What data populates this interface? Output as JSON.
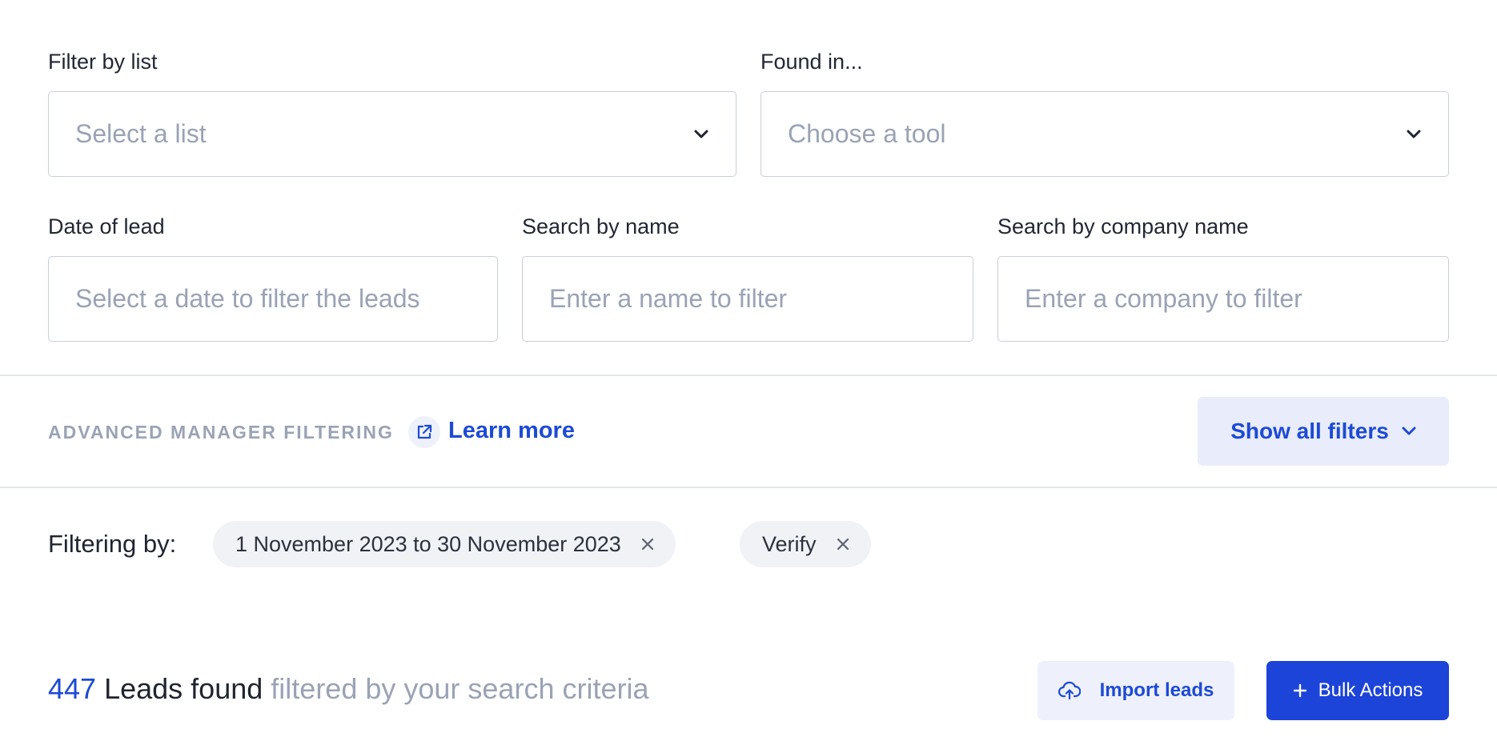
{
  "filters": {
    "list": {
      "label": "Filter by list",
      "placeholder": "Select a list"
    },
    "found_in": {
      "label": "Found in...",
      "placeholder": "Choose a tool"
    },
    "date": {
      "label": "Date of lead",
      "placeholder": "Select a date to filter the leads"
    },
    "name": {
      "label": "Search by name",
      "placeholder": "Enter a name to filter"
    },
    "company": {
      "label": "Search by company name",
      "placeholder": "Enter a company to filter"
    }
  },
  "advanced": {
    "title": "ADVANCED MANAGER FILTERING",
    "learn_more": "Learn more",
    "show_all": "Show all filters"
  },
  "active_filters": {
    "label": "Filtering by:",
    "chips": [
      "1 November 2023 to 30 November 2023",
      "Verify"
    ]
  },
  "results": {
    "count": "447",
    "found": "Leads found",
    "qualifier": "filtered by your search criteria",
    "import_label": "Import leads",
    "bulk_label": "Bulk Actions"
  },
  "icons": {
    "chevron": "chevron-down-icon",
    "external": "external-link-icon",
    "close": "close-icon",
    "upload": "cloud-upload-icon",
    "plus": "plus-icon"
  },
  "colors": {
    "accent": "#1d4ad6",
    "primary_button": "#1d44d8",
    "muted_text": "#9aa3b4"
  }
}
